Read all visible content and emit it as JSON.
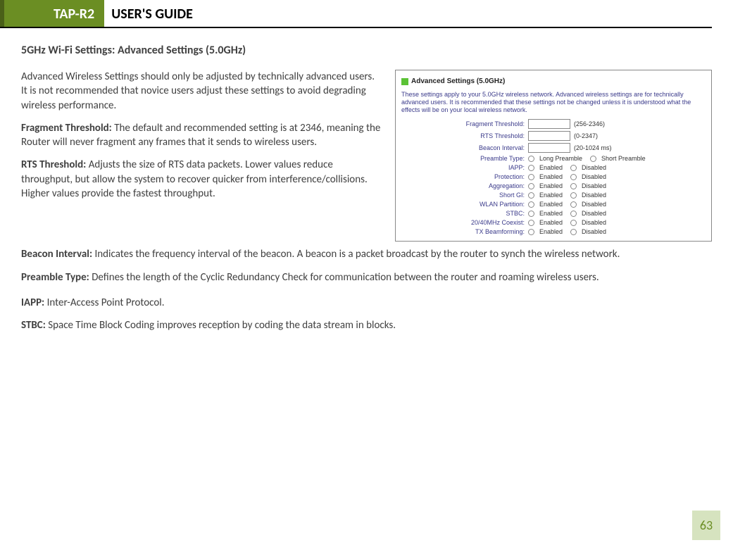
{
  "header": {
    "badge": "TAP-R2",
    "title": "USER'S GUIDE"
  },
  "section_title": "5GHz Wi-Fi Settings: Advanced Settings (5.0GHz)",
  "intro": "Advanced Wireless Settings should only be adjusted by technically advanced users. It is not recommended that novice users adjust these settings to avoid degrading wireless performance.",
  "frag": {
    "label": "Fragment Threshold:",
    "text": " The default and recommended setting is at 2346, meaning the Router will never fragment any frames that it sends to wireless users."
  },
  "rts": {
    "label": "RTS Threshold:",
    "text": " Adjusts the size of RTS data packets. Lower values reduce throughput, but allow the system to recover quicker from interference/collisions. Higher values provide the fastest throughput."
  },
  "beacon": {
    "label": "Beacon Interval:",
    "text": " Indicates the frequency interval of the beacon. A beacon is a packet broadcast by the router to synch the wireless network."
  },
  "preamble": {
    "label": "Preamble Type:",
    "text": " Defines the length of the Cyclic Redundancy Check for communication between the router and roaming wireless users."
  },
  "iapp": {
    "label": "IAPP:",
    "text": " Inter-Access Point Protocol."
  },
  "stbc": {
    "label": "STBC:",
    "text": " Space Time Block Coding improves reception by coding the data stream in blocks."
  },
  "panel": {
    "title": "Advanced Settings (5.0GHz)",
    "desc": "These settings apply to your 5.0GHz wireless network. Advanced wireless settings are for technically advanced users. It is recommended that these settings not be changed unless it is understood what the effects will be on your local wireless network.",
    "rows": [
      {
        "label": "Fragment Threshold:",
        "type": "input",
        "hint": "(256-2346)"
      },
      {
        "label": "RTS Threshold:",
        "type": "input",
        "hint": "(0-2347)"
      },
      {
        "label": "Beacon Interval:",
        "type": "input",
        "hint": "(20-1024 ms)"
      },
      {
        "label": "Preamble Type:",
        "type": "radio2",
        "opt1": "Long Preamble",
        "opt2": "Short Preamble"
      },
      {
        "label": "IAPP:",
        "type": "radio2",
        "opt1": "Enabled",
        "opt2": "Disabled"
      },
      {
        "label": "Protection:",
        "type": "radio2",
        "opt1": "Enabled",
        "opt2": "Disabled"
      },
      {
        "label": "Aggregation:",
        "type": "radio2",
        "opt1": "Enabled",
        "opt2": "Disabled"
      },
      {
        "label": "Short GI:",
        "type": "radio2",
        "opt1": "Enabled",
        "opt2": "Disabled"
      },
      {
        "label": "WLAN Partition:",
        "type": "radio2",
        "opt1": "Enabled",
        "opt2": "Disabled"
      },
      {
        "label": "STBC:",
        "type": "radio2",
        "opt1": "Enabled",
        "opt2": "Disabled"
      },
      {
        "label": "20/40MHz Coexist:",
        "type": "radio2",
        "opt1": "Enabled",
        "opt2": "Disabled"
      },
      {
        "label": "TX Beamforming:",
        "type": "radio2",
        "opt1": "Enabled",
        "opt2": "Disabled"
      }
    ]
  },
  "page_number": "63"
}
